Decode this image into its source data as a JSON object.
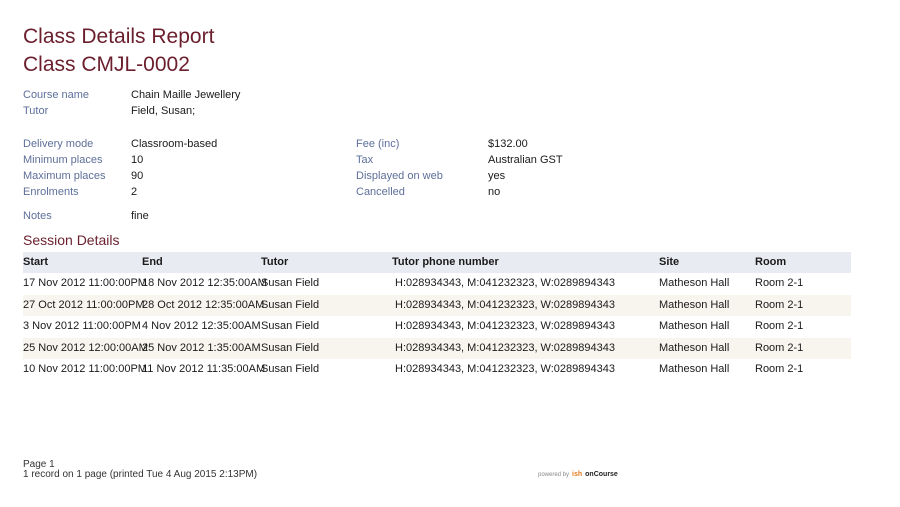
{
  "report": {
    "title": "Class Details Report",
    "class_code": "Class CMJL-0002"
  },
  "details": {
    "course_name_label": "Course name",
    "course_name": "Chain Maille Jewellery",
    "tutor_label": "Tutor",
    "tutor": "Field, Susan;",
    "delivery_mode_label": "Delivery mode",
    "delivery_mode": "Classroom-based",
    "min_places_label": "Minimum places",
    "min_places": "10",
    "max_places_label": "Maximum places",
    "max_places": "90",
    "enrolments_label": "Enrolments",
    "enrolments": "2",
    "fee_label": "Fee (inc)",
    "fee": "$132.00",
    "tax_label": "Tax",
    "tax": "Australian GST",
    "displayed_label": "Displayed on web",
    "displayed": "yes",
    "cancelled_label": "Cancelled",
    "cancelled": "no",
    "notes_label": "Notes",
    "notes": "fine"
  },
  "sessions": {
    "title": "Session Details",
    "headers": {
      "start": "Start",
      "end": "End",
      "tutor": "Tutor",
      "phone": "Tutor phone number",
      "site": "Site",
      "room": "Room"
    },
    "rows": [
      {
        "start": "17 Nov 2012 11:00:00PM",
        "end": "18 Nov 2012 12:35:00AM",
        "tutor": "Susan Field",
        "phone": "H:028934343, M:041232323, W:0289894343",
        "site": "Matheson Hall",
        "room": "Room 2-1"
      },
      {
        "start": "27 Oct 2012 11:00:00PM",
        "end": "28 Oct 2012 12:35:00AM",
        "tutor": "Susan Field",
        "phone": "H:028934343, M:041232323, W:0289894343",
        "site": "Matheson Hall",
        "room": "Room 2-1"
      },
      {
        "start": "3 Nov 2012 11:00:00PM",
        "end": "4 Nov 2012 12:35:00AM",
        "tutor": "Susan Field",
        "phone": "H:028934343, M:041232323, W:0289894343",
        "site": "Matheson Hall",
        "room": "Room 2-1"
      },
      {
        "start": "25 Nov 2012 12:00:00AM",
        "end": "25 Nov 2012 1:35:00AM",
        "tutor": "Susan Field",
        "phone": "H:028934343, M:041232323, W:0289894343",
        "site": "Matheson Hall",
        "room": "Room 2-1"
      },
      {
        "start": "10 Nov 2012 11:00:00PM",
        "end": "11 Nov 2012 11:35:00AM",
        "tutor": "Susan Field",
        "phone": "H:028934343, M:041232323, W:0289894343",
        "site": "Matheson Hall",
        "room": "Room 2-1"
      }
    ]
  },
  "footer": {
    "page": "Page 1",
    "summary": "1 record on 1 page (printed Tue 4 Aug 2015 2:13PM)",
    "powered_by": "powered by",
    "logo_mark": "ish",
    "logo_text": "onCourse"
  }
}
